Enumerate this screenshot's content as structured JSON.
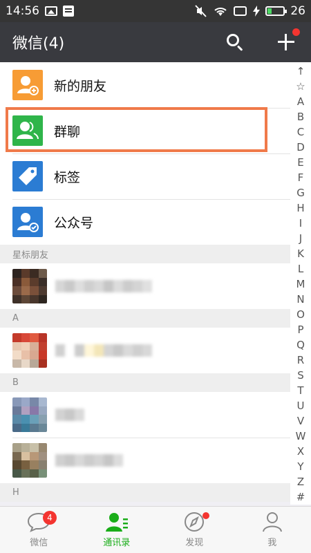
{
  "status_bar": {
    "time": "14:56",
    "battery_level": "26"
  },
  "header": {
    "title": "微信(4)"
  },
  "function_items": [
    {
      "label": "新的朋友",
      "icon": "add-friend-icon",
      "color": "#f79c35"
    },
    {
      "label": "群聊",
      "icon": "group-chat-icon",
      "color": "#2fb54a"
    },
    {
      "label": "标签",
      "icon": "tag-icon",
      "color": "#2b7cd3"
    },
    {
      "label": "公众号",
      "icon": "official-account-icon",
      "color": "#2b7cd3"
    }
  ],
  "sections": [
    {
      "header": "星标朋友"
    },
    {
      "header": "A"
    },
    {
      "header": "B"
    },
    {
      "header": "H"
    }
  ],
  "index_letters": [
    "↑",
    "☆",
    "A",
    "B",
    "C",
    "D",
    "E",
    "F",
    "G",
    "H",
    "I",
    "J",
    "K",
    "L",
    "M",
    "N",
    "O",
    "P",
    "Q",
    "R",
    "S",
    "T",
    "U",
    "V",
    "W",
    "X",
    "Y",
    "Z",
    "#"
  ],
  "tabs": [
    {
      "label": "微信",
      "badge": "4"
    },
    {
      "label": "通讯录"
    },
    {
      "label": "发现"
    },
    {
      "label": "我"
    }
  ],
  "colors": {
    "accent": "#1aad19",
    "highlight": "#f07a4a",
    "badge": "#f43530"
  }
}
